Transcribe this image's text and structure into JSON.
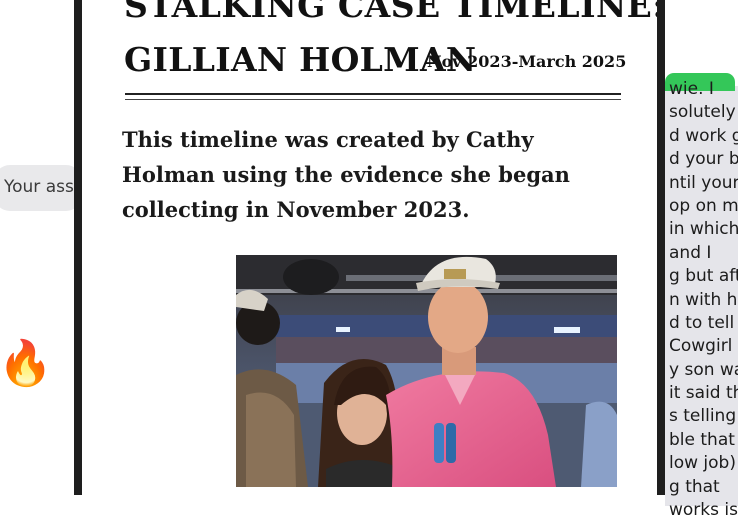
{
  "left_bubble": {
    "text": "Your ass"
  },
  "left_emoji": {
    "glyph": "🔥",
    "name": "fire-emoji"
  },
  "document": {
    "title_line1": "STALKING CASE TIMELINE:",
    "title_line2": "GILLIAN HOLMAN",
    "date_range": "Nov 2023-March 2025",
    "intro": "This timeline was created by Cathy Holman using the evidence she began collecting in November 2023."
  },
  "right_message_fragments": [
    "wie. I",
    "solutely",
    "d work g",
    "d your b",
    "ntil your",
    "op on my",
    "in which",
    "and I",
    "g but afte",
    "n with hi",
    "d to tell y",
    "Cowgirl C",
    "y son was",
    "it said th",
    "s telling",
    "ble that s",
    "low job)",
    "g that",
    "works is"
  ],
  "colors": {
    "imessage_green": "#34c759",
    "imessage_gray": "#e5e5ea",
    "doc_border": "#1e1e1e"
  }
}
